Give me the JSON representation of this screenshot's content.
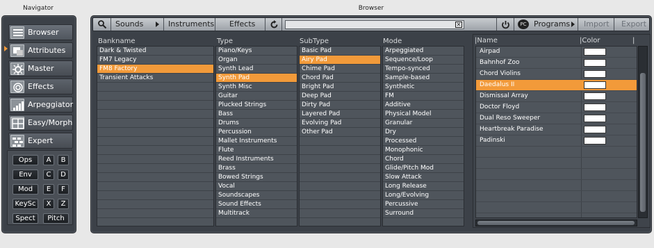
{
  "navigator": {
    "title": "Navigator",
    "items": [
      {
        "label": "Browser",
        "icon": "browser-icon"
      },
      {
        "label": "Attributes",
        "icon": "attributes-icon"
      },
      {
        "label": "Master",
        "icon": "master-icon"
      },
      {
        "label": "Effects",
        "icon": "effects-icon"
      },
      {
        "label": "Arpeggiator",
        "icon": "arpeggiator-icon"
      },
      {
        "label": "Easy/Morph",
        "icon": "easy-morph-icon"
      },
      {
        "label": "Expert",
        "icon": "expert-icon"
      }
    ],
    "mini": [
      "Ops",
      "A",
      "B",
      "Env",
      "C",
      "D",
      "Mod",
      "E",
      "F",
      "KeySc",
      "X",
      "Z",
      "Spect",
      "Pitch"
    ]
  },
  "browser": {
    "title": "Browser",
    "toolbar": {
      "sounds": "Sounds",
      "instruments": "Instruments",
      "effects": "Effects",
      "search_value": "",
      "programs": "Programs",
      "import": "Import",
      "export": "Export"
    },
    "columns": {
      "bankname": {
        "header": "Bankname",
        "items": [
          "Dark & Twisted",
          "FM7 Legacy",
          "FM8 Factory",
          "Transient Attacks"
        ],
        "selected": 2
      },
      "type": {
        "header": "Type",
        "items": [
          "Piano/Keys",
          "Organ",
          "Synth Lead",
          "Synth Pad",
          "Synth Misc",
          "Guitar",
          "Plucked Strings",
          "Bass",
          "Drums",
          "Percussion",
          "Mallet Instruments",
          "Flute",
          "Reed Instruments",
          "Brass",
          "Bowed Strings",
          "Vocal",
          "Soundscapes",
          "Sound Effects",
          "Multitrack"
        ],
        "selected": 3
      },
      "subtype": {
        "header": "SubType",
        "items": [
          "Basic Pad",
          "Airy Pad",
          "Chime Pad",
          "Chord Pad",
          "Bright Pad",
          "Deep Pad",
          "Dirty Pad",
          "Layered Pad",
          "Evolving Pad",
          "Other Pad"
        ],
        "selected": 1
      },
      "mode": {
        "header": "Mode",
        "items": [
          "Arpeggiated",
          "Sequence/Loop",
          "Tempo-synced",
          "Sample-based",
          "Synthetic",
          "FM",
          "Additive",
          "Physical Model",
          "Granular",
          "Dry",
          "Processed",
          "Monophonic",
          "Chord",
          "Glide/Pitch Mod",
          "Slow Attack",
          "Long Release",
          "Long/Evolving",
          "Percussive",
          "Surround"
        ],
        "selected": -1
      }
    },
    "programs": {
      "name_header": "Name",
      "color_header": "Color",
      "items": [
        "Airpad",
        "Bahnhof Zoo",
        "Chord Violins",
        "Daedalus II",
        "Dismissal Array",
        "Doctor Floyd",
        "Dual Reso Sweeper",
        "Heartbreak Paradise",
        "Padinski"
      ],
      "selected": 3
    }
  },
  "colors": {
    "accent": "#f29a3a",
    "panel": "#3c4148",
    "list_bg": "#4f555c"
  }
}
